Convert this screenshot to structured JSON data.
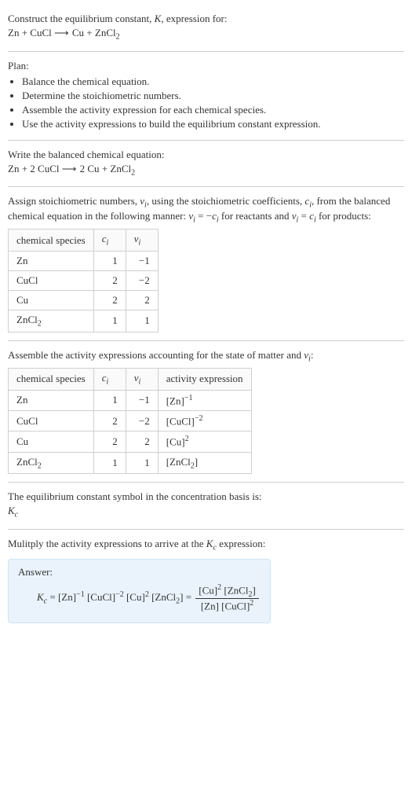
{
  "intro": {
    "prompt": "Construct the equilibrium constant, K, expression for:",
    "unbalanced": "Zn + CuCl  ⟶  Cu + ZnCl₂"
  },
  "plan": {
    "heading": "Plan:",
    "items": [
      "Balance the chemical equation.",
      "Determine the stoichiometric numbers.",
      "Assemble the activity expression for each chemical species.",
      "Use the activity expressions to build the equilibrium constant expression."
    ]
  },
  "balanced": {
    "heading": "Write the balanced chemical equation:",
    "equation": "Zn + 2 CuCl  ⟶  2 Cu + ZnCl₂"
  },
  "stoich": {
    "heading": "Assign stoichiometric numbers, νᵢ, using the stoichiometric coefficients, cᵢ, from the balanced chemical equation in the following manner: νᵢ = −cᵢ for reactants and νᵢ = cᵢ for products:",
    "headers": {
      "species": "chemical species",
      "ci": "cᵢ",
      "vi": "νᵢ"
    },
    "rows": [
      {
        "species": "Zn",
        "ci": "1",
        "vi": "−1"
      },
      {
        "species": "CuCl",
        "ci": "2",
        "vi": "−2"
      },
      {
        "species": "Cu",
        "ci": "2",
        "vi": "2"
      },
      {
        "species": "ZnCl₂",
        "ci": "1",
        "vi": "1"
      }
    ]
  },
  "activity": {
    "heading": "Assemble the activity expressions accounting for the state of matter and νᵢ:",
    "headers": {
      "species": "chemical species",
      "ci": "cᵢ",
      "vi": "νᵢ",
      "act": "activity expression"
    },
    "rows": [
      {
        "species": "Zn",
        "ci": "1",
        "vi": "−1",
        "act": "[Zn]⁻¹"
      },
      {
        "species": "CuCl",
        "ci": "2",
        "vi": "−2",
        "act": "[CuCl]⁻²"
      },
      {
        "species": "Cu",
        "ci": "2",
        "vi": "2",
        "act": "[Cu]²"
      },
      {
        "species": "ZnCl₂",
        "ci": "1",
        "vi": "1",
        "act": "[ZnCl₂]"
      }
    ]
  },
  "symbol": {
    "heading": "The equilibrium constant symbol in the concentration basis is:",
    "value": "K𝒸"
  },
  "result": {
    "heading": "Mulitply the activity expressions to arrive at the K𝒸 expression:",
    "answer_label": "Answer:",
    "lhs": "K𝒸 = [Zn]⁻¹ [CuCl]⁻² [Cu]² [ZnCl₂] = ",
    "frac_num": "[Cu]² [ZnCl₂]",
    "frac_den": "[Zn] [CuCl]²"
  }
}
